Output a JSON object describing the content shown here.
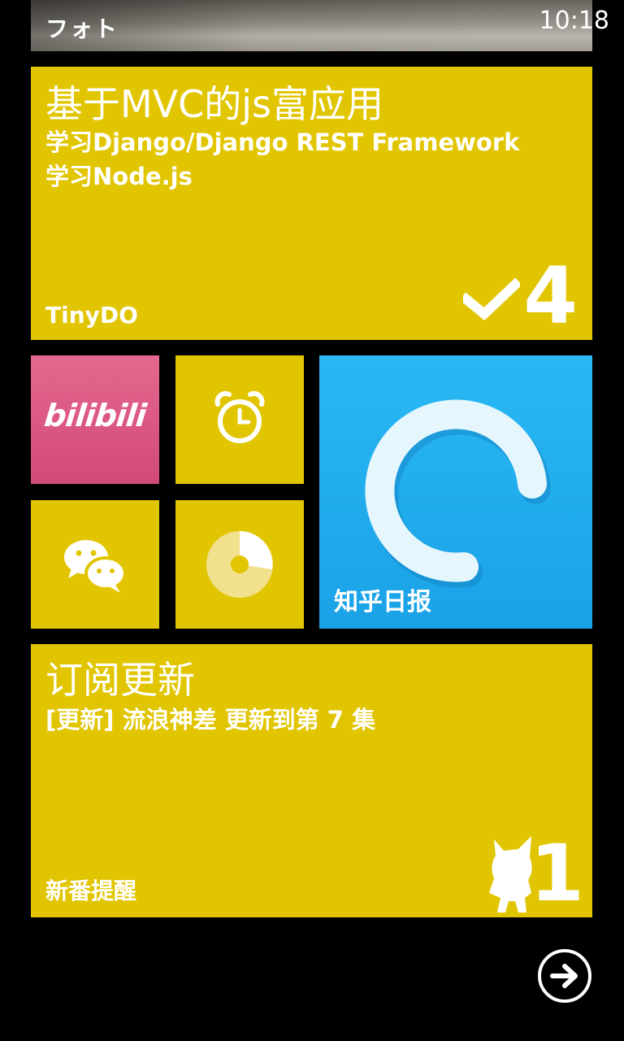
{
  "status_bar": {
    "time": "10:18"
  },
  "photo_tile": {
    "label": "フォト"
  },
  "tinydo_tile": {
    "title": "基于MVC的js富应用",
    "items": [
      "学习Django/Django REST Framework",
      "学习Node.js"
    ],
    "app_name": "TinyDO",
    "count": "4",
    "icon": "checkmark-icon"
  },
  "bilibili_tile": {
    "logo_text": "bilibili"
  },
  "alarm_tile": {
    "icon": "alarm-clock-icon"
  },
  "wechat_tile": {
    "icon": "chat-bubbles-icon"
  },
  "pie_tile": {
    "icon": "pie-chart-icon"
  },
  "zhihu_tile": {
    "app_name": "知乎日报",
    "icon": "open-circle-icon"
  },
  "subscribe_tile": {
    "title": "订阅更新",
    "item": "[更新] 流浪神差 更新到第 7 集",
    "app_name": "新番提醒",
    "count": "1",
    "icon": "anime-girl-icon"
  },
  "next_button": {
    "icon": "arrow-right-circle-icon"
  },
  "colors": {
    "accent": "#e1c500",
    "zhihu": "#1aa2e6",
    "bilibili": "#d9537f",
    "background": "#000000"
  }
}
